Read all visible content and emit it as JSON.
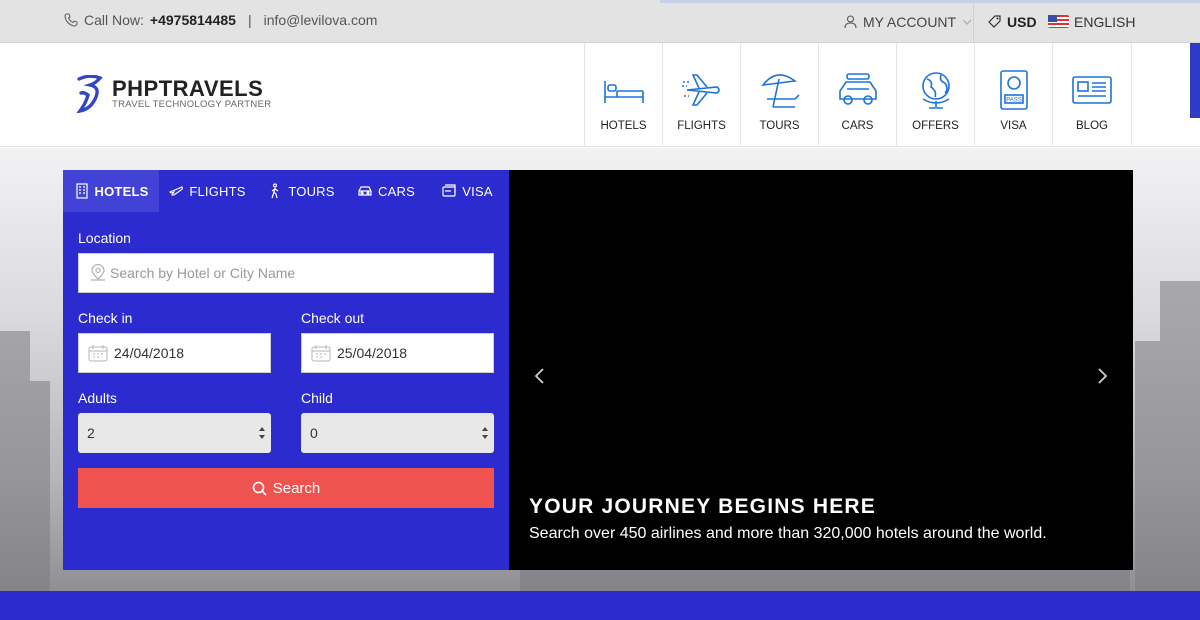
{
  "topbar": {
    "call_label": "Call Now:",
    "phone": "+4975814485",
    "separator": "|",
    "email": "info@levilova.com",
    "account_label": "MY ACCOUNT",
    "currency": "USD",
    "language": "ENGLISH"
  },
  "logo": {
    "title": "PHPTRAVELS",
    "subtitle": "TRAVEL TECHNOLOGY PARTNER"
  },
  "nav": [
    {
      "label": "HOTELS",
      "icon": "bed-icon"
    },
    {
      "label": "FLIGHTS",
      "icon": "plane-icon"
    },
    {
      "label": "TOURS",
      "icon": "beach-umbrella-icon"
    },
    {
      "label": "CARS",
      "icon": "car-icon"
    },
    {
      "label": "OFFERS",
      "icon": "globe-icon"
    },
    {
      "label": "VISA",
      "icon": "passport-icon"
    },
    {
      "label": "BLOG",
      "icon": "blog-card-icon"
    }
  ],
  "search": {
    "tabs": [
      {
        "label": "HOTELS",
        "icon": "building-icon",
        "active": true
      },
      {
        "label": "FLIGHTS",
        "icon": "plane-icon",
        "active": false
      },
      {
        "label": "TOURS",
        "icon": "hiker-icon",
        "active": false
      },
      {
        "label": "CARS",
        "icon": "car-icon",
        "active": false
      },
      {
        "label": "VISA",
        "icon": "card-icon",
        "active": false
      }
    ],
    "location_label": "Location",
    "location_placeholder": "Search by Hotel or City Name",
    "checkin_label": "Check in",
    "checkin_value": "24/04/2018",
    "checkout_label": "Check out",
    "checkout_value": "25/04/2018",
    "adults_label": "Adults",
    "adults_value": "2",
    "child_label": "Child",
    "child_value": "0",
    "button_label": "Search"
  },
  "slider": {
    "title": "YOUR JOURNEY BEGINS HERE",
    "subtitle": "Search over 450 airlines and more than 320,000 hotels around the world."
  },
  "colors": {
    "brand_blue": "#2b2bcf",
    "search_red": "#ef5350",
    "icon_blue": "#1e73d8"
  }
}
